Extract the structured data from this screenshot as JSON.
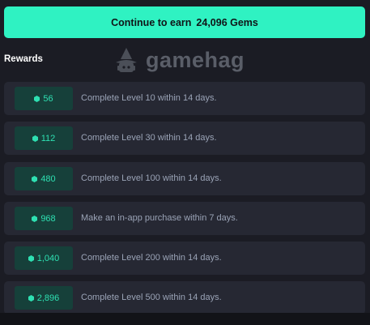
{
  "cta": {
    "prefix": "Continue to earn",
    "amount": "24,096 Gems"
  },
  "rewards_title": "Rewards",
  "logo": {
    "wordmark": "gamehag"
  },
  "colors": {
    "accent": "#2ff2c2",
    "gem": "#2ee0b2",
    "badge_bg": "#16403a",
    "row_bg": "#262833",
    "page_bg": "#1b1c24"
  },
  "rewards": [
    {
      "gems": "56",
      "task": "Complete Level 10 within 14 days."
    },
    {
      "gems": "112",
      "task": "Complete Level 30 within 14 days."
    },
    {
      "gems": "480",
      "task": "Complete Level 100 within 14 days."
    },
    {
      "gems": "968",
      "task": "Make an in-app purchase within 7 days."
    },
    {
      "gems": "1,040",
      "task": "Complete Level 200 within 14 days."
    },
    {
      "gems": "2,896",
      "task": "Complete Level 500 within 14 days."
    }
  ]
}
